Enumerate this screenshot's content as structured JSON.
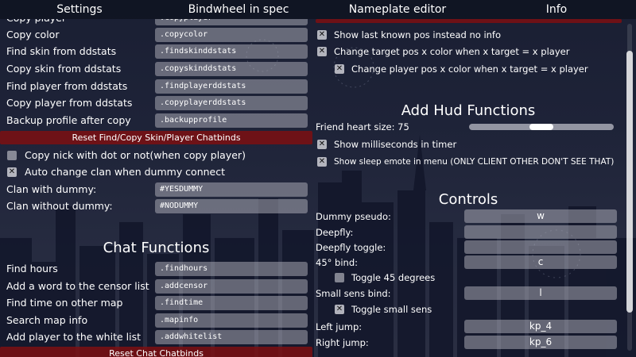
{
  "tabs": [
    "Settings",
    "Bindwheel in spec",
    "Nameplate editor",
    "Info"
  ],
  "left": {
    "cut_label": "Copy player",
    "cut_value": ".copyplayer",
    "rows1": [
      {
        "label": "Copy color",
        "value": ".copycolor"
      },
      {
        "label": "Find skin from ddstats",
        "value": ".findskinddstats"
      },
      {
        "label": "Copy skin from ddstats",
        "value": ".copyskinddstats"
      },
      {
        "label": "Find player from ddstats",
        "value": ".findplayerddstats"
      },
      {
        "label": "Copy player from ddstats",
        "value": ".copyplayerddstats"
      },
      {
        "label": "Backup profile after copy",
        "value": ".backupprofile"
      }
    ],
    "reset_find_copy": "Reset Find/Copy Skin/Player Chatbinds",
    "check_copy_nick": "Copy nick with dot or not(when copy player)",
    "check_auto_clan": "Auto change clan when dummy connect",
    "clan_rows": [
      {
        "label": "Clan with dummy:",
        "value": "#YESDUMMY"
      },
      {
        "label": "Clan without dummy:",
        "value": "#NODUMMY"
      }
    ],
    "chat_title": "Chat Functions",
    "chat_rows": [
      {
        "label": "Find hours",
        "value": ".findhours"
      },
      {
        "label": "Add a word to the censor list",
        "value": ".addcensor"
      },
      {
        "label": "Find time on other map",
        "value": ".findtime"
      },
      {
        "label": "Search map info",
        "value": ".mapinfo"
      },
      {
        "label": "Add player to the white list",
        "value": ".addwhitelist"
      }
    ],
    "reset_chat": "Reset Chat Chatbinds"
  },
  "right": {
    "check_last_pos": "Show last known pos instead no info",
    "check_target_pos": "Change target pos x color when x target = x player",
    "check_player_pos": "Change player pos x color when x target = x player",
    "hud_title": "Add Hud Functions",
    "heart_label": "Friend heart size: 75",
    "heart_level": 0.5,
    "check_millis": "Show milliseconds in timer",
    "check_sleep": "Show sleep emote in menu (ONLY CLIENT OTHER DON'T SEE THAT)",
    "controls_title": "Controls",
    "binds": [
      {
        "label": "Dummy pseudo:",
        "value": "w"
      },
      {
        "label": "Deepfly:",
        "value": ""
      },
      {
        "label": "Deepfly toggle:",
        "value": ""
      },
      {
        "label": "45° bind:",
        "value": "c"
      }
    ],
    "toggle45": "Toggle 45 degrees",
    "small_sens_label": "Small sens bind:",
    "small_sens_value": "l",
    "toggle_small": "Toggle small sens",
    "jumps": [
      {
        "label": "Left jump:",
        "value": "kp_4"
      },
      {
        "label": "Right jump:",
        "value": "kp_6"
      }
    ]
  },
  "check_mark": "✕",
  "colors": {
    "accent_red": "#7d0f12"
  }
}
